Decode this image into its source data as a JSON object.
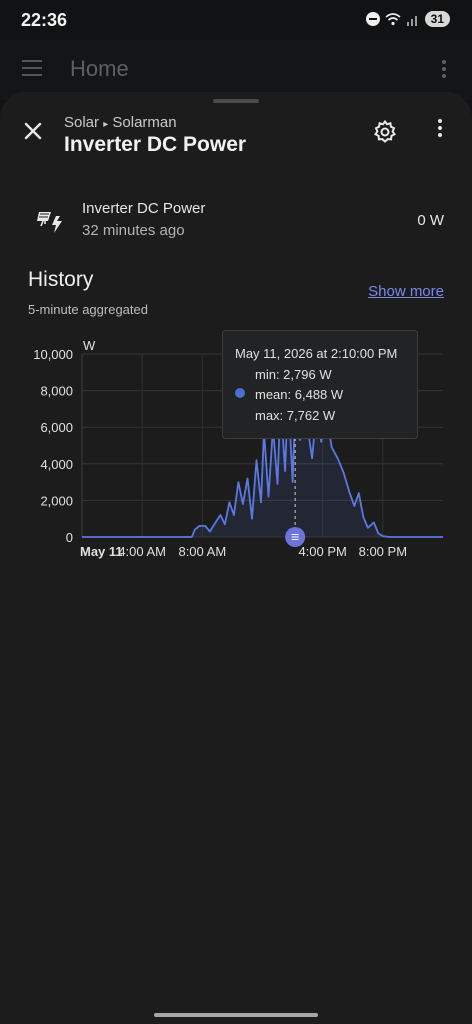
{
  "status_bar": {
    "time": "22:36",
    "battery": "31"
  },
  "app_bar": {
    "title": "Home"
  },
  "dialog": {
    "breadcrumb_area": "Solar",
    "breadcrumb_sep": "▸",
    "breadcrumb_device": "Solarman",
    "title": "Inverter DC Power"
  },
  "entity": {
    "name": "Inverter DC Power",
    "last_changed": "32 minutes ago",
    "state": "0 W"
  },
  "history": {
    "title": "History",
    "subtitle": "5-minute aggregated",
    "show_more": "Show more"
  },
  "tooltip": {
    "title": "May 11, 2026 at 2:10:00 PM",
    "min": "min: 2,796 W",
    "mean": "mean: 6,488 W",
    "max": "max: 7,762 W"
  },
  "chart_data": {
    "type": "line",
    "unit": "W",
    "ylim": [
      0,
      10000
    ],
    "yticks": [
      "10,000",
      "8,000",
      "6,000",
      "4,000",
      "2,000",
      "0"
    ],
    "xticks": [
      {
        "label": "May 11",
        "hour": 0,
        "bold": true
      },
      {
        "label": "4:00 AM",
        "hour": 4
      },
      {
        "label": "8:00 AM",
        "hour": 8
      },
      {
        "label": "4:00 PM",
        "hour": 16
      },
      {
        "label": "8:00 PM",
        "hour": 20
      }
    ],
    "x_hours_range": [
      0,
      24
    ],
    "grid": true,
    "line_color": "#5b78e0",
    "series": [
      {
        "values": [
          [
            0,
            0
          ],
          [
            7.3,
            0
          ],
          [
            7.5,
            400
          ],
          [
            7.8,
            600
          ],
          [
            8.2,
            600
          ],
          [
            8.5,
            300
          ],
          [
            8.8,
            700
          ],
          [
            9.2,
            1200
          ],
          [
            9.5,
            700
          ],
          [
            9.8,
            1900
          ],
          [
            10.1,
            1200
          ],
          [
            10.4,
            3000
          ],
          [
            10.7,
            1800
          ],
          [
            11,
            3200
          ],
          [
            11.3,
            1000
          ],
          [
            11.6,
            4200
          ],
          [
            11.9,
            1900
          ],
          [
            12.1,
            5800
          ],
          [
            12.4,
            2200
          ],
          [
            12.7,
            6000
          ],
          [
            13,
            2900
          ],
          [
            13.2,
            7500
          ],
          [
            13.5,
            3600
          ],
          [
            13.7,
            8000
          ],
          [
            14,
            3000
          ],
          [
            14.2,
            7700
          ],
          [
            14.5,
            5300
          ],
          [
            14.8,
            7000
          ],
          [
            15,
            6000
          ],
          [
            15.3,
            4300
          ],
          [
            15.6,
            7000
          ],
          [
            15.9,
            5200
          ],
          [
            16.2,
            7000
          ],
          [
            16.6,
            4900
          ],
          [
            17,
            4300
          ],
          [
            17.4,
            3500
          ],
          [
            17.8,
            2400
          ],
          [
            18.1,
            1700
          ],
          [
            18.4,
            2400
          ],
          [
            18.7,
            1100
          ],
          [
            19,
            500
          ],
          [
            19.4,
            800
          ],
          [
            19.7,
            200
          ],
          [
            20,
            50
          ],
          [
            20.5,
            0
          ],
          [
            24,
            0
          ]
        ]
      }
    ],
    "cursor_hour": 14.17
  }
}
